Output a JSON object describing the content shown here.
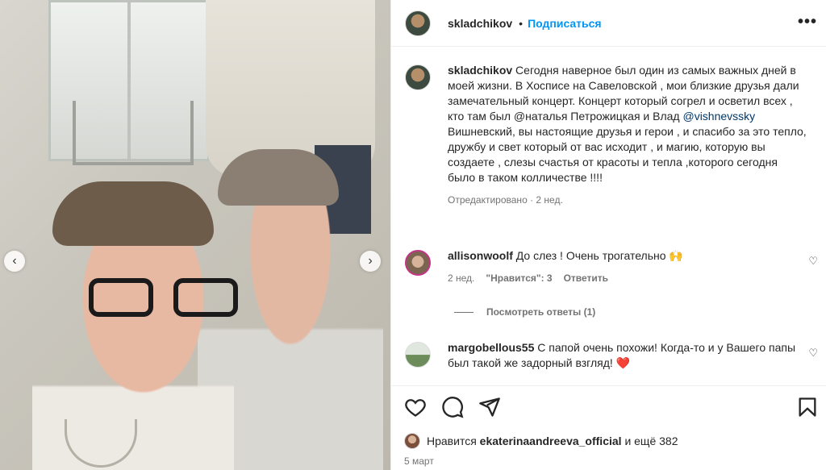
{
  "post": {
    "username": "skladchikov",
    "follow_label": "Подписаться",
    "separator": "•",
    "more_label": "•••"
  },
  "caption": {
    "username": "skladchikov",
    "text_before": "Сегодня наверное был один из самых важных дней в моей жизни. В Хосписе на Савеловской , мои близкие друзья дали замечательный концерт. Концерт который согрел и осветил всех , кто там был @наталья Петрожицкая и Влад ",
    "mention": "@vishnevssky",
    "text_after": " Вишневский, вы настоящие друзья и герои , и спасибо за это тепло, дружбу и свет который от вас исходит , и магию, которую вы создаете , слезы счастья от красоты и тепла ,которого сегодня было в таком колличестве !!!!",
    "meta": "Отредактировано · 2 нед."
  },
  "comments": [
    {
      "username": "allisonwoolf",
      "text": "До слез ! Очень трогательно 🙌",
      "time": "2 нед.",
      "likes": "\"Нравится\": 3",
      "reply": "Ответить"
    },
    {
      "username": "margobellous55",
      "text": "С папой очень похожи! Когда-то и у Вашего папы был такой же задорный взгляд! ❤️"
    }
  ],
  "view_replies": "Посмотреть ответы (1)",
  "likes": {
    "prefix": "Нравится",
    "user": "ekaterinaandreeva_official",
    "suffix": "и ещё 382"
  },
  "date": "5 март",
  "nav": {
    "prev": "‹",
    "next": "›"
  },
  "icons": {
    "like": "heart-icon",
    "comment": "comment-icon",
    "share": "send-icon",
    "save": "bookmark-icon"
  }
}
